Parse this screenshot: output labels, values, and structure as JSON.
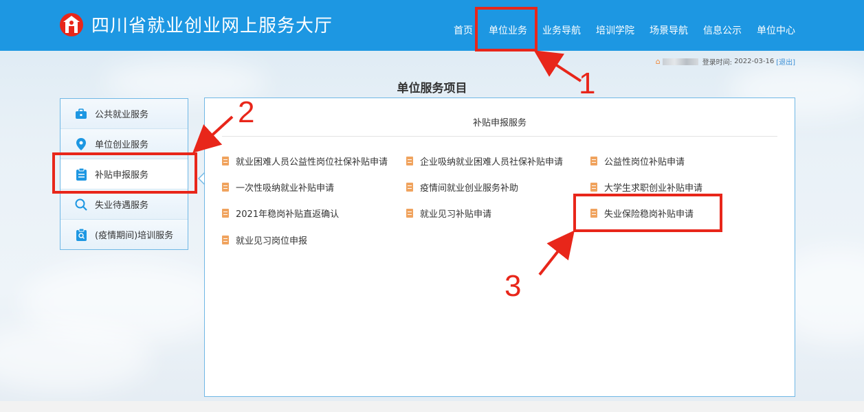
{
  "header": {
    "site_title": "四川省就业创业网上服务大厅",
    "nav": [
      "首页",
      "单位业务",
      "业务导航",
      "培训学院",
      "场景导航",
      "信息公示",
      "单位中心"
    ]
  },
  "userbar": {
    "login_label": "登录时间:",
    "login_date": "2022-03-16",
    "logout": "[退出]"
  },
  "page_title": "单位服务项目",
  "sidebar": {
    "items": [
      {
        "label": "公共就业服务",
        "icon": "briefcase-icon"
      },
      {
        "label": "单位创业服务",
        "icon": "location-pin-icon"
      },
      {
        "label": "补贴申报服务",
        "icon": "clipboard-icon",
        "active": true
      },
      {
        "label": "失业待遇服务",
        "icon": "search-icon"
      },
      {
        "label": "(疫情期间)培训服务",
        "icon": "clipboard-search-icon"
      }
    ]
  },
  "panel": {
    "title": "补贴申报服务",
    "services": [
      "就业困难人员公益性岗位社保补贴申请",
      "企业吸纳就业困难人员社保补贴申请",
      "公益性岗位补贴申请",
      "一次性吸纳就业补贴申请",
      "疫情间就业创业服务补助",
      "大学生求职创业补贴申请",
      "2021年稳岗补贴直返确认",
      "就业见习补贴申请",
      "失业保险稳岗补贴申请",
      "就业见习岗位申报"
    ]
  },
  "annotations": [
    "1",
    "2",
    "3"
  ],
  "colors": {
    "header": "#1d97e2",
    "highlight": "#e8261a",
    "accent_icon": "#f0a35e"
  }
}
